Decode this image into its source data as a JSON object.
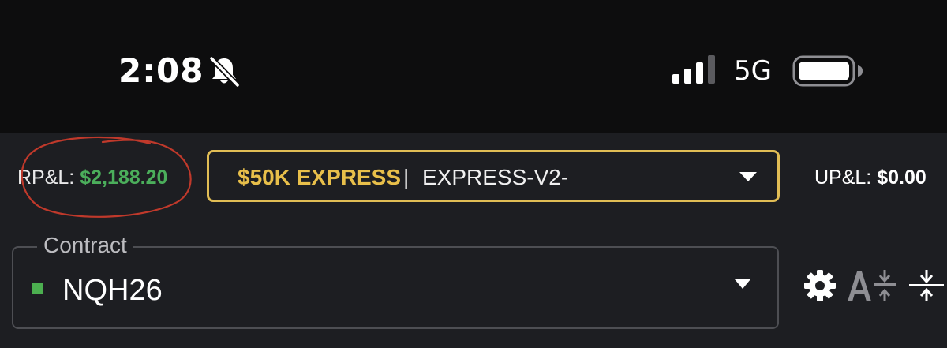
{
  "status_bar": {
    "time": "2:08",
    "network": "5G",
    "icons": [
      "bell-slash-icon",
      "cellular-signal-icon",
      "battery-icon"
    ]
  },
  "header": {
    "rpl_label": "RP&L:",
    "rpl_value": "$2,188.20",
    "account": {
      "name": "$50K EXPRESS",
      "separator": "|",
      "id": "EXPRESS-V2-"
    },
    "upl_label": "UP&L:",
    "upl_value": "$0.00"
  },
  "contract": {
    "label": "Contract",
    "value": "NQH26",
    "status_color": "#4caf50"
  },
  "toolbar": {
    "icons": [
      "gear-icon",
      "text-size-icon",
      "compact-rows-icon"
    ]
  },
  "colors": {
    "accent_gold": "#e1bd55",
    "profit_green": "#4bae5b",
    "background": "#1d1e22",
    "annotation_red": "#c0392b"
  }
}
